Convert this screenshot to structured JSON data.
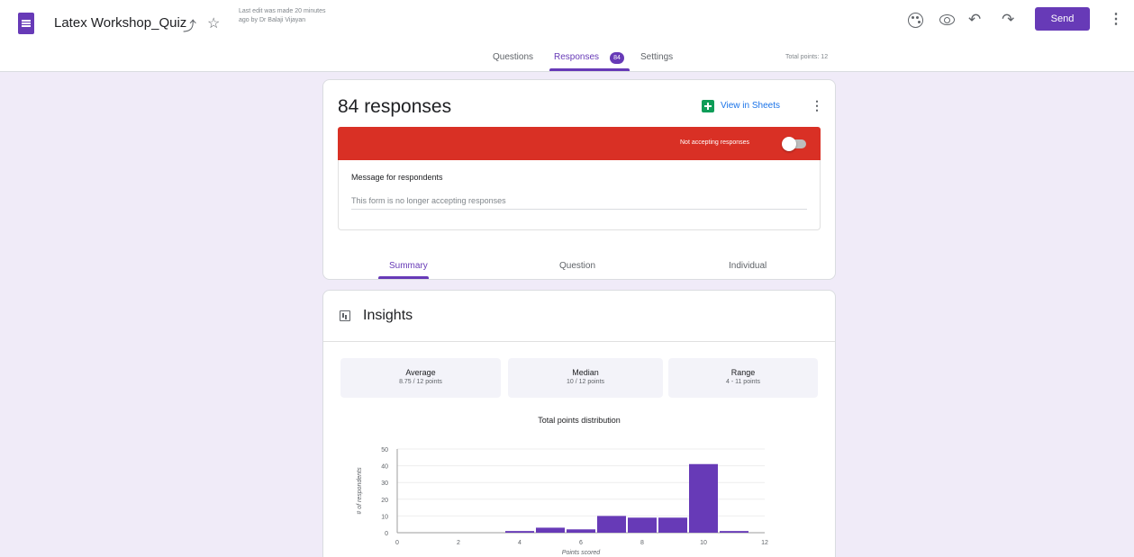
{
  "header": {
    "doc_title": "Latex Workshop_Quiz",
    "last_edit": "Last edit was made 20 minutes ago by Dr Balaji Vijayan",
    "send_label": "Send",
    "tabs": {
      "questions": "Questions",
      "responses": "Responses",
      "responses_badge": "84",
      "settings": "Settings"
    },
    "total_points": "Total points: 12"
  },
  "summary_card": {
    "response_count": "84 responses",
    "view_in_sheets": "View in Sheets",
    "banner_text": "Not accepting responses",
    "message_title": "Message for respondents",
    "message_text": "This form is no longer accepting responses",
    "subtabs": {
      "summary": "Summary",
      "question": "Question",
      "individual": "Individual"
    }
  },
  "insights": {
    "title": "Insights",
    "average_label": "Average",
    "average_value": "8.75 / 12 points",
    "median_label": "Median",
    "median_value": "10 / 12 points",
    "range_label": "Range",
    "range_value": "4 - 11 points"
  },
  "colors": {
    "accent": "#673ab7",
    "banner": "#d93025",
    "sheets": "#0f9d58",
    "background": "#f0ebf8"
  },
  "chart_data": {
    "type": "bar",
    "title": "Total points distribution",
    "xlabel": "Points scored",
    "ylabel": "# of respondents",
    "x": [
      4,
      5,
      6,
      7,
      8,
      9,
      10,
      11
    ],
    "values": [
      1,
      3,
      2,
      10,
      9,
      9,
      41,
      1
    ],
    "xlim": [
      0,
      12
    ],
    "ylim": [
      0,
      50
    ],
    "xticks": [
      0,
      2,
      4,
      6,
      8,
      10,
      12
    ],
    "yticks": [
      0,
      10,
      20,
      30,
      40,
      50
    ],
    "grid": true,
    "bar_color": "#673ab7"
  }
}
